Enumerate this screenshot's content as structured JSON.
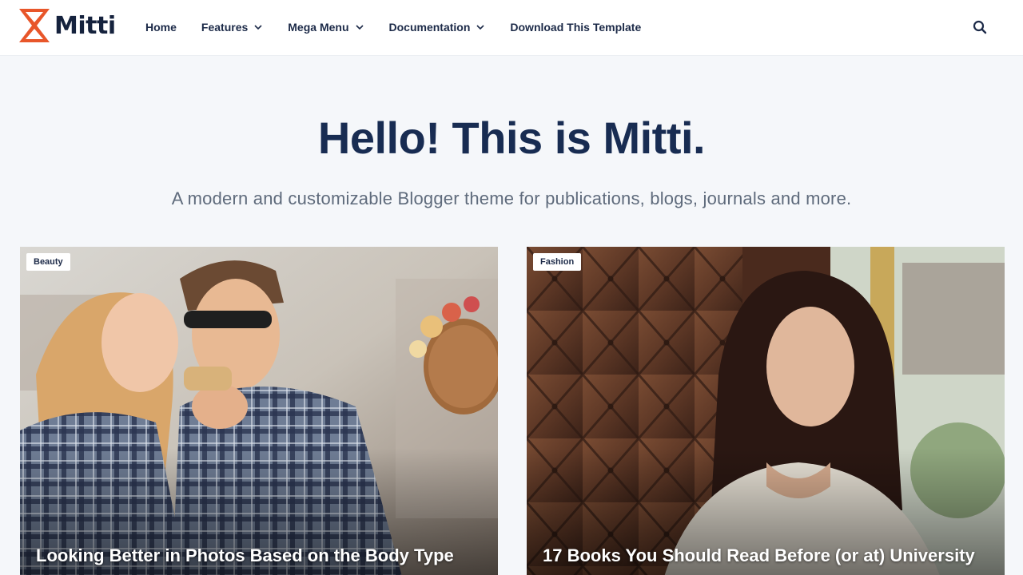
{
  "brand": {
    "name": "Mitti",
    "accent_color": "#e8562a",
    "icon": "hourglass-logo-icon"
  },
  "nav": {
    "items": [
      {
        "label": "Home",
        "has_dropdown": false
      },
      {
        "label": "Features",
        "has_dropdown": true
      },
      {
        "label": "Mega Menu",
        "has_dropdown": true
      },
      {
        "label": "Documentation",
        "has_dropdown": true
      },
      {
        "label": "Download This Template",
        "has_dropdown": false
      }
    ],
    "search_icon": "search-icon"
  },
  "hero": {
    "title": "Hello! This is Mitti.",
    "subtitle": "A modern and customizable Blogger theme for publications, blogs, journals and more."
  },
  "posts": [
    {
      "category": "Beauty",
      "title": "Looking Better in Photos Based on the Body Type"
    },
    {
      "category": "Fashion",
      "title": "17 Books You Should Read Before (or at) University"
    }
  ]
}
